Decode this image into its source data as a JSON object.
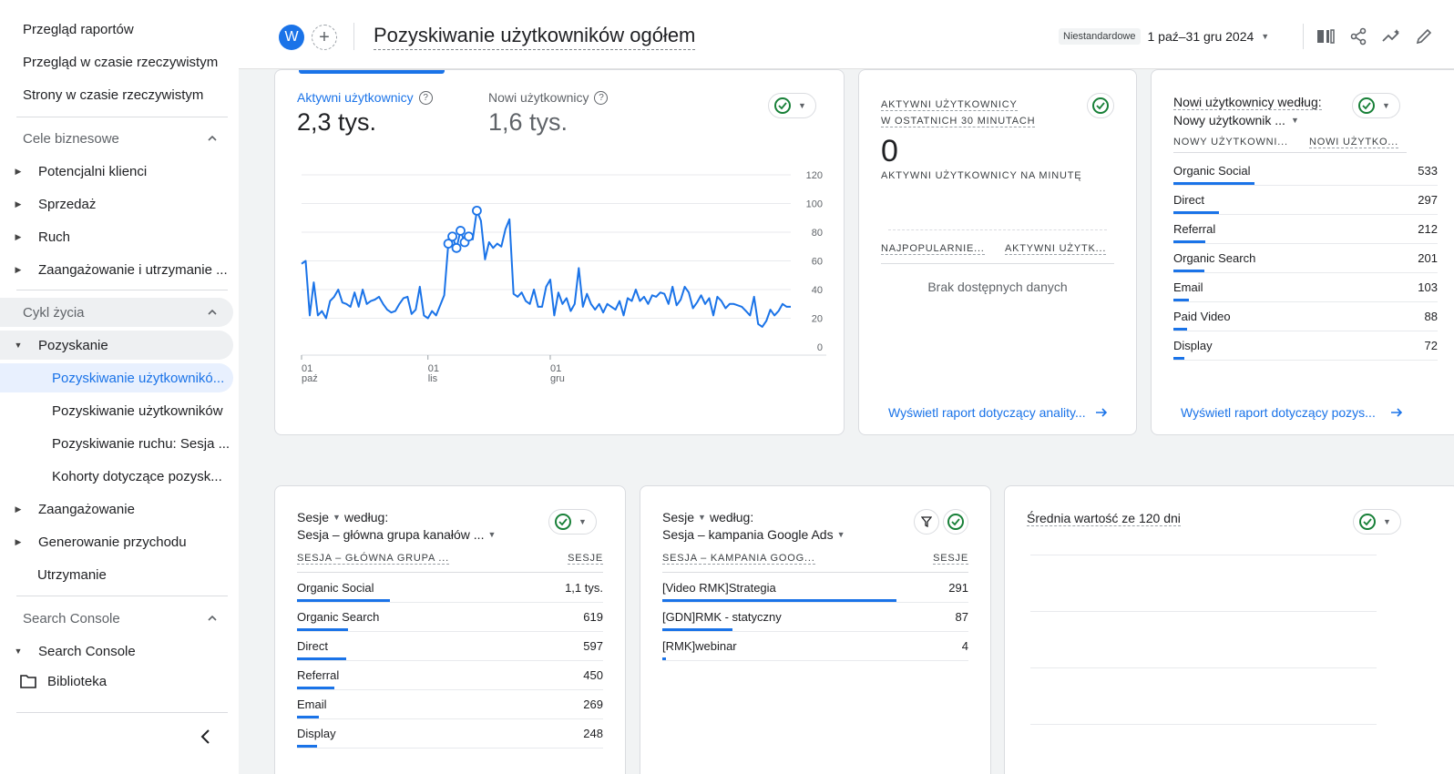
{
  "sidebar": {
    "top_items": [
      "Przegląd raportów",
      "Przegląd w czasie rzeczywistym",
      "Strony w czasie rzeczywistym"
    ],
    "business_goals": {
      "label": "Cele biznesowe",
      "items": [
        "Potencjalni klienci",
        "Sprzedaż",
        "Ruch",
        "Zaangażowanie i utrzymanie ..."
      ]
    },
    "lifecycle": {
      "label": "Cykl życia",
      "acquisition": "Pozyskanie",
      "sub_items": [
        "Pozyskiwanie użytkownikó...",
        "Pozyskiwanie użytkowników",
        "Pozyskiwanie ruchu: Sesja ...",
        "Kohorty dotyczące pozysk..."
      ],
      "rest": [
        "Zaangażowanie",
        "Generowanie przychodu",
        "Utrzymanie"
      ]
    },
    "search_console": {
      "label": "Search Console",
      "item": "Search Console"
    },
    "library": "Biblioteka"
  },
  "header": {
    "avatar_letter": "W",
    "add_symbol": "+",
    "title": "Pozyskiwanie użytkowników ogółem",
    "date_chip": "Niestandardowe",
    "date_range": "1 paź–31 gru 2024"
  },
  "line_card": {
    "metric1_label": "Aktywni użytkownicy",
    "metric1_value": "2,3 tys.",
    "metric2_label": "Nowi użytkownicy",
    "metric2_value": "1,6 tys.",
    "help_symbol": "?"
  },
  "chart_data": {
    "type": "line",
    "series": [
      {
        "values": [
          58,
          60,
          22,
          45,
          22,
          25,
          20,
          32,
          35,
          40,
          31,
          30,
          28,
          38,
          28,
          40,
          30,
          32,
          33,
          35,
          30,
          26,
          24,
          25,
          30,
          34,
          35,
          23,
          26,
          42,
          22,
          20,
          25,
          22,
          29,
          36,
          72,
          77,
          69,
          81,
          73,
          77,
          75,
          95,
          88,
          61,
          73,
          69,
          72,
          70,
          82,
          89,
          37,
          35,
          38,
          32,
          30,
          40,
          28,
          28,
          42,
          47,
          22,
          38,
          30,
          34,
          25,
          30,
          55,
          28,
          37,
          30,
          26,
          30,
          24,
          30,
          28,
          26,
          32,
          22,
          34,
          32,
          40,
          32,
          35,
          30,
          36,
          35,
          38,
          37,
          30,
          42,
          29,
          33,
          42,
          38,
          27,
          31,
          36,
          30,
          34,
          22,
          35,
          32,
          27,
          30,
          30,
          29,
          28,
          25,
          22,
          35,
          16,
          14,
          18,
          26,
          22,
          25,
          30,
          28,
          28
        ],
        "color": "#1a73e8"
      }
    ],
    "x_ticks": [
      {
        "day": "01",
        "month": "paź"
      },
      {
        "day": "01",
        "month": "lis"
      },
      {
        "day": "01",
        "month": "gru"
      }
    ],
    "y_ticks": [
      "120",
      "100",
      "80",
      "60",
      "40",
      "20",
      "0"
    ],
    "ylim": [
      0,
      120
    ],
    "grid": true,
    "highlighted_points": [
      36,
      37,
      38,
      39,
      40,
      41,
      43
    ]
  },
  "realtime_card": {
    "title_line1": "AKTYWNI UŻYTKOWNICY",
    "title_line2": "W OSTATNICH 30 MINUTACH",
    "value": "0",
    "per_minute": "AKTYWNI UŻYTKOWNICY NA MINUTĘ",
    "col1": "NAJPOPULARNIE...",
    "col2": "AKTYWNI UŻYTK...",
    "no_data": "Brak dostępnych danych",
    "link": "Wyświetl raport dotyczący anality..."
  },
  "new_users_card": {
    "title": "Nowi użytkownicy według:",
    "dimension": "Nowy użytkownik ...",
    "col1": "NOWY UŻYTKOWNI...",
    "col2": "NOWI UŻYTKO...",
    "rows": [
      {
        "label": "Organic Social",
        "value": "533",
        "fill": 1.0
      },
      {
        "label": "Direct",
        "value": "297",
        "fill": 0.557
      },
      {
        "label": "Referral",
        "value": "212",
        "fill": 0.398
      },
      {
        "label": "Organic Search",
        "value": "201",
        "fill": 0.377
      },
      {
        "label": "Email",
        "value": "103",
        "fill": 0.193
      },
      {
        "label": "Paid Video",
        "value": "88",
        "fill": 0.165
      },
      {
        "label": "Display",
        "value": "72",
        "fill": 0.135
      }
    ],
    "link": "Wyświetl raport dotyczący pozys..."
  },
  "sessions_channel_card": {
    "title_metric": "Sesje",
    "title_suffix": "według:",
    "dimension": "Sesja – główna grupa kanałów ...",
    "col1": "SESJA – GŁÓWNA GRUPA ...",
    "col2": "SESJE",
    "rows": [
      {
        "label": "Organic Social",
        "value": "1,1 tys.",
        "fill": 1.0
      },
      {
        "label": "Organic Search",
        "value": "619",
        "fill": 0.55
      },
      {
        "label": "Direct",
        "value": "597",
        "fill": 0.53
      },
      {
        "label": "Referral",
        "value": "450",
        "fill": 0.4
      },
      {
        "label": "Email",
        "value": "269",
        "fill": 0.24
      },
      {
        "label": "Display",
        "value": "248",
        "fill": 0.22
      }
    ]
  },
  "sessions_ads_card": {
    "title_metric": "Sesje",
    "title_suffix": "według:",
    "dimension": "Sesja – kampania Google Ads",
    "col1": "SESJA – KAMPANIA GOOG...",
    "col2": "SESJE",
    "rows": [
      {
        "label": "[Video RMK]Strategia",
        "value": "291",
        "fill": 1.0
      },
      {
        "label": "[GDN]RMK - statyczny",
        "value": "87",
        "fill": 0.3
      },
      {
        "label": "[RMK]webinar",
        "value": "4",
        "fill": 0.014
      }
    ]
  },
  "avg_value_card": {
    "title": "Średnia wartość ze 120 dni"
  }
}
